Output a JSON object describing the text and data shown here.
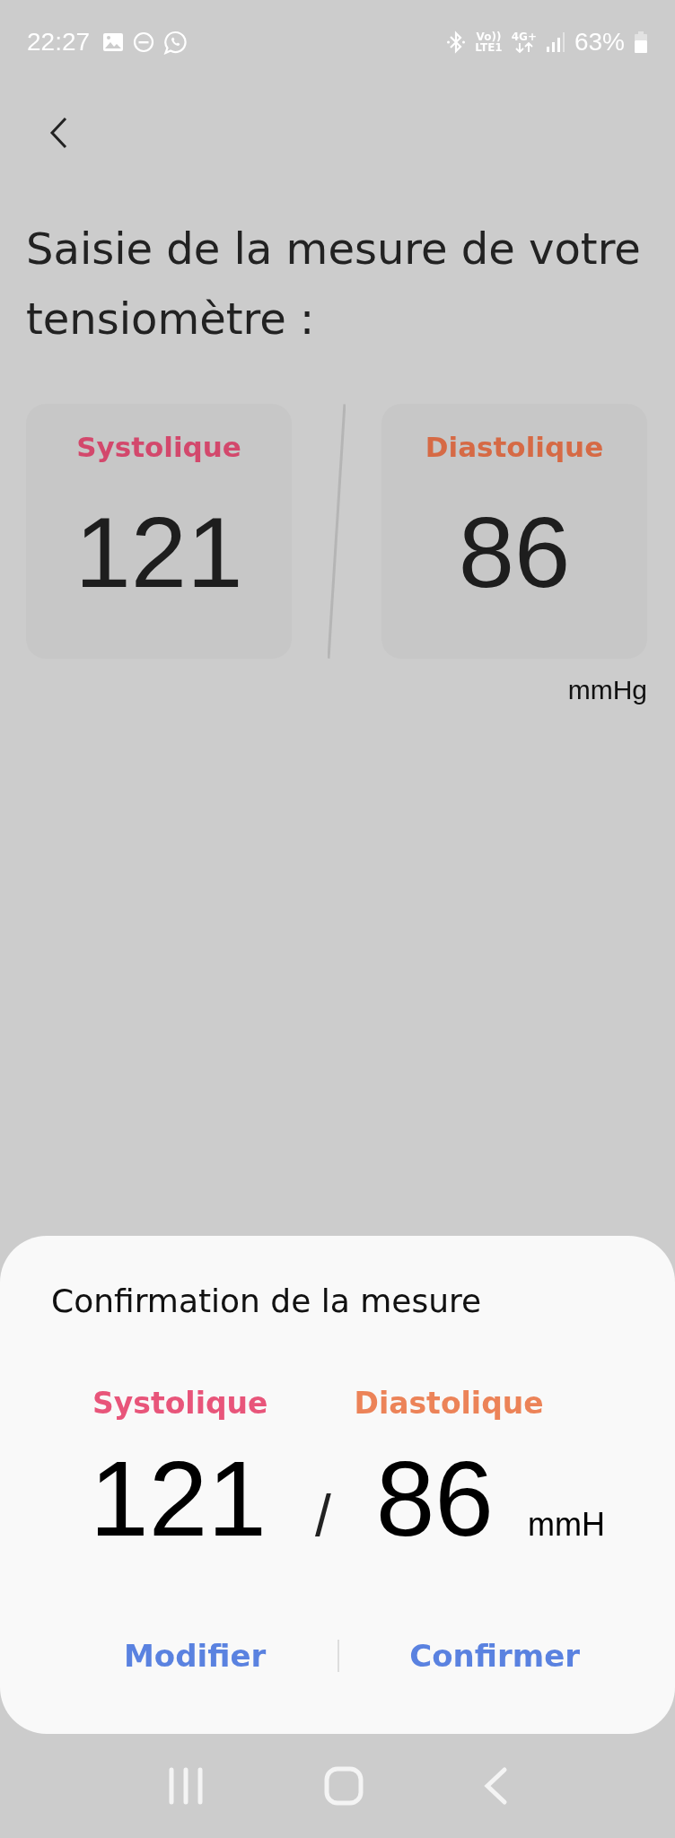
{
  "status_bar": {
    "time": "22:27",
    "volte": "Vo))",
    "lte": "LTE1",
    "data_type": "4G+",
    "battery": "63%"
  },
  "title": "Saisie de la mesure de votre tensiomètre :",
  "measurements": [
    {
      "label": "Systolique",
      "value": "121",
      "color": "#d3486c"
    },
    {
      "label": "Diastolique",
      "value": "86",
      "color": "#d66a45"
    }
  ],
  "unit": "mmHg",
  "sheet": {
    "title": "Confirmation de la mesure",
    "measurements": [
      {
        "label": "Systolique",
        "value": "121",
        "color": "#e8557a"
      },
      {
        "label": "Diastolique",
        "value": "86",
        "color": "#ec8358"
      }
    ],
    "separator": "/",
    "unit": "mmH",
    "buttons": [
      "Modifier",
      "Confirmer"
    ]
  }
}
